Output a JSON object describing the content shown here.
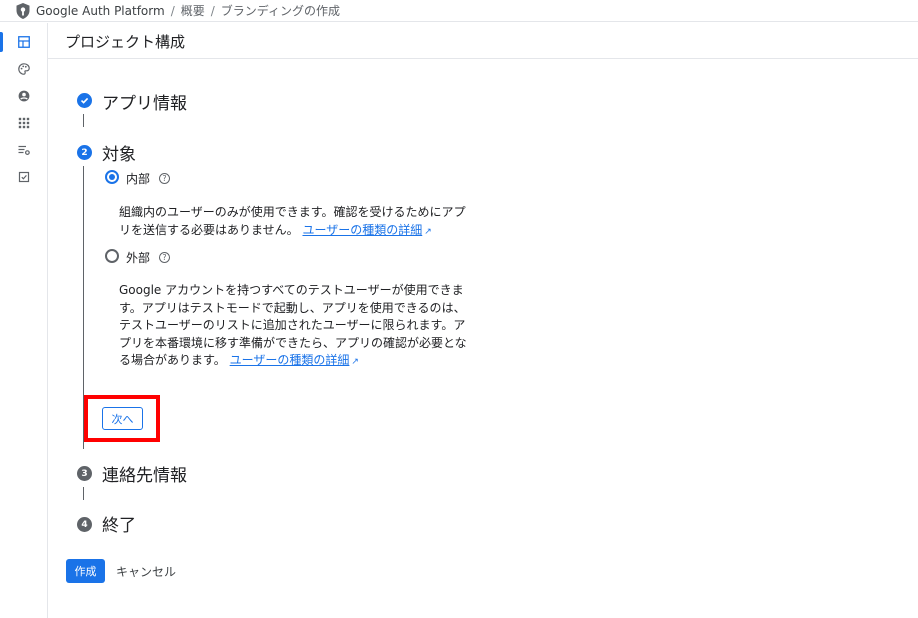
{
  "breadcrumb": {
    "items": [
      "Google Auth Platform",
      "概要",
      "ブランディングの作成"
    ],
    "separator": "/"
  },
  "rail": {
    "items": [
      {
        "icon": "dashboard-icon",
        "active": true
      },
      {
        "icon": "palette-icon",
        "active": false
      },
      {
        "icon": "account-circle-icon",
        "active": false
      },
      {
        "icon": "apps-grid-icon",
        "active": false
      },
      {
        "icon": "list-settings-icon",
        "active": false
      },
      {
        "icon": "checkbox-icon",
        "active": false
      }
    ]
  },
  "page": {
    "title": "プロジェクト構成"
  },
  "steps": [
    {
      "number": "",
      "title": "アプリ情報",
      "state": "done"
    },
    {
      "number": "2",
      "title": "対象",
      "state": "current"
    },
    {
      "number": "3",
      "title": "連絡先情報",
      "state": "pending"
    },
    {
      "number": "4",
      "title": "終了",
      "state": "pending"
    }
  ],
  "audience": {
    "internal": {
      "label": "内部",
      "checked": true,
      "description": "組織内のユーザーのみが使用できます。確認を受けるためにアプリを送信する必要はありません。",
      "link": "ユーザーの種類の詳細"
    },
    "external": {
      "label": "外部",
      "checked": false,
      "description": "Google アカウントを持つすべてのテストユーザーが使用できます。アプリはテストモードで起動し、アプリを使用できるのは、テストユーザーのリストに追加されたユーザーに限られます。アプリを本番環境に移す準備ができたら、アプリの確認が必要となる場合があります。",
      "link": "ユーザーの種類の詳細"
    },
    "help_glyph": "?",
    "external_link_glyph": "↗"
  },
  "buttons": {
    "next": "次へ",
    "create": "作成",
    "cancel": "キャンセル"
  },
  "colors": {
    "accent": "#1a73e8",
    "highlight": "#ff0000",
    "pending_step": "#5f6368"
  }
}
